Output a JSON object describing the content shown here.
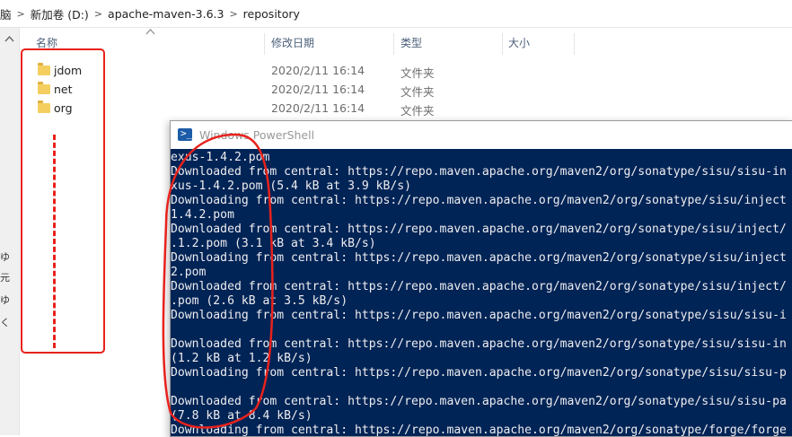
{
  "breadcrumb": {
    "items": [
      "脑",
      "新加卷 (D:)",
      "apache-maven-3.6.3",
      "repository"
    ],
    "separator": ">"
  },
  "left_gutter": {
    "chars": [
      "ゆ",
      "元",
      "ゆ",
      "く"
    ]
  },
  "columns": {
    "name": "名称",
    "date": "修改日期",
    "type": "类型",
    "size": "大小"
  },
  "files": [
    {
      "name": "jdom",
      "date": "2020/2/11 16:14",
      "type": "文件夹"
    },
    {
      "name": "net",
      "date": "2020/2/11 16:14",
      "type": "文件夹"
    },
    {
      "name": "org",
      "date": "2020/2/11 16:14",
      "type": "文件夹"
    }
  ],
  "powershell": {
    "title": "Windows PowerShell",
    "lines": [
      "exus-1.4.2.pom",
      "Downloaded from central: https://repo.maven.apache.org/maven2/org/sonatype/sisu/sisu-in",
      "xus-1.4.2.pom (5.4 kB at 3.9 kB/s)",
      "Downloading from central: https://repo.maven.apache.org/maven2/org/sonatype/sisu/inject",
      "1.4.2.pom",
      "Downloaded from central: https://repo.maven.apache.org/maven2/org/sonatype/sisu/inject/",
      ".1.2.pom (3.1 kB at 3.4 kB/s)",
      "Downloading from central: https://repo.maven.apache.org/maven2/org/sonatype/sisu/inject",
      "2.pom",
      "Downloaded from central: https://repo.maven.apache.org/maven2/org/sonatype/sisu/inject/",
      ".pom (2.6 kB at 3.5 kB/s)",
      "Downloading from central: https://repo.maven.apache.org/maven2/org/sonatype/sisu/sisu-i",
      "",
      "Downloaded from central: https://repo.maven.apache.org/maven2/org/sonatype/sisu/sisu-in",
      "(1.2 kB at 1.2 kB/s)",
      "Downloading from central: https://repo.maven.apache.org/maven2/org/sonatype/sisu/sisu-p",
      "",
      "Downloaded from central: https://repo.maven.apache.org/maven2/org/sonatype/sisu/sisu-pa",
      "(7.8 kB at 8.4 kB/s)",
      "Downloading from central: https://repo.maven.apache.org/maven2/org/sonatype/forge/forge"
    ]
  },
  "colors": {
    "console_bg": "#012456",
    "console_fg": "#eeedf0",
    "annotation": "#e8221c",
    "folder": "#f4cf60"
  }
}
